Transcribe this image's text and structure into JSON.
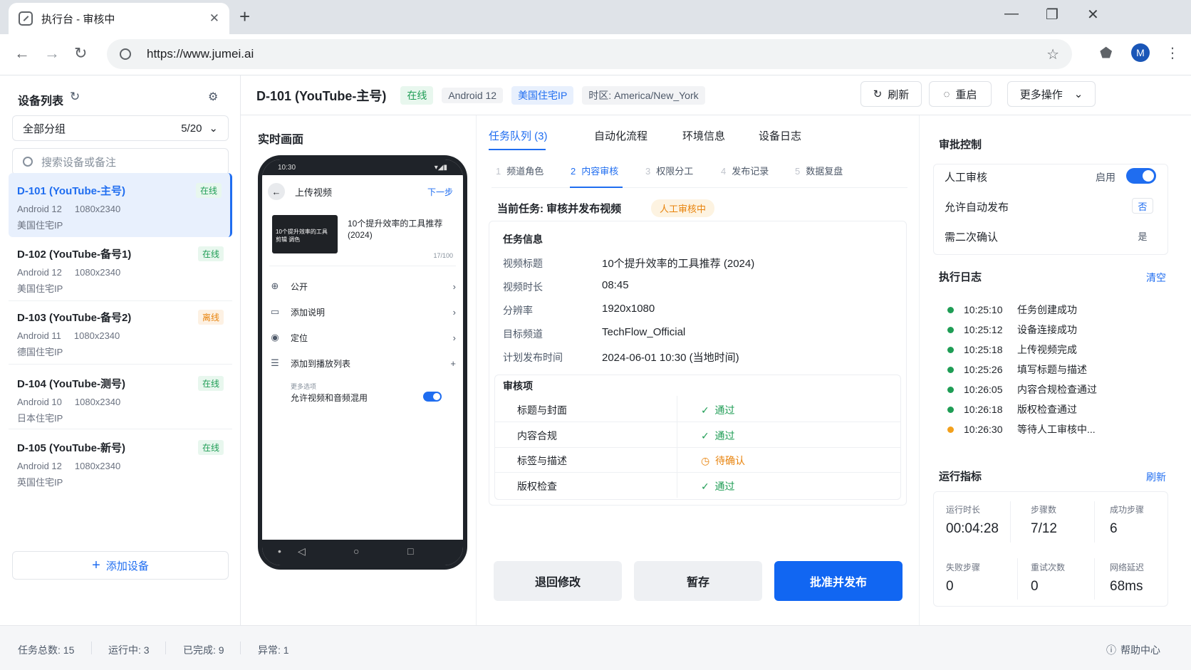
{
  "browser": {
    "tab_title": "执行台 - 审核中",
    "url": "https://www.jumei.ai",
    "avatar_letter": "M"
  },
  "sidebar": {
    "title": "设备列表",
    "group": {
      "label": "全部分组",
      "count": "5/20"
    },
    "search_placeholder": "搜索设备或备注",
    "devices": [
      {
        "name": "D-101 (YouTube-主号)",
        "status": "在线",
        "os": "Android 12",
        "res": "1080x2340",
        "loc": "美国住宅IP"
      },
      {
        "name": "D-102 (YouTube-备号1)",
        "status": "在线",
        "os": "Android 12",
        "res": "1080x2340",
        "loc": "美国住宅IP"
      },
      {
        "name": "D-103 (YouTube-备号2)",
        "status": "离线",
        "os": "Android 11",
        "res": "1080x2340",
        "loc": "德国住宅IP"
      },
      {
        "name": "D-104 (YouTube-测号)",
        "status": "在线",
        "os": "Android 10",
        "res": "1080x2340",
        "loc": "日本住宅IP"
      },
      {
        "name": "D-105 (YouTube-新号)",
        "status": "在线",
        "os": "Android 12",
        "res": "1080x2340",
        "loc": "英国住宅IP"
      }
    ],
    "add_device": "添加设备"
  },
  "header": {
    "device_title": "D-101 (YouTube-主号)",
    "tags": {
      "status": "在线",
      "os": "Android 12",
      "ip": "美国住宅IP",
      "tz": "时区: America/New_York"
    },
    "refresh": "刷新",
    "restart": "重启",
    "more": "更多操作"
  },
  "live": {
    "title": "实时画面",
    "status_time": "10:30",
    "status_icons": "▾◢▮",
    "page_title": "上传视频",
    "next": "下一步",
    "thumb_text": "10个提升效率的工具 剪辑 调色",
    "video_title": "10个提升效率的工具推荐 (2024)",
    "char_count": "17/100",
    "rows": [
      {
        "label": "公开",
        "icon": "globe-icon",
        "action": "›"
      },
      {
        "label": "添加说明",
        "icon": "comment-icon",
        "action": "›"
      },
      {
        "label": "定位",
        "icon": "location-icon",
        "action": "›"
      },
      {
        "label": "添加到播放列表",
        "icon": "playlist-icon",
        "action": "+"
      }
    ],
    "more_options": "更多选项",
    "mix_audio": "允许视频和音频混用"
  },
  "main_tabs": [
    "任务队列 (3)",
    "自动化流程",
    "环境信息",
    "设备日志"
  ],
  "steps": [
    {
      "n": "1",
      "label": "频道角色"
    },
    {
      "n": "2",
      "label": "内容审核"
    },
    {
      "n": "3",
      "label": "权限分工"
    },
    {
      "n": "4",
      "label": "发布记录"
    },
    {
      "n": "5",
      "label": "数据复盘"
    }
  ],
  "task": {
    "current": "当前任务: 审核并发布视频",
    "state": "人工审核中",
    "info_title": "任务信息",
    "info": [
      {
        "k": "视频标题",
        "v": "10个提升效率的工具推荐 (2024)"
      },
      {
        "k": "视频时长",
        "v": "08:45"
      },
      {
        "k": "分辨率",
        "v": "1920x1080"
      },
      {
        "k": "目标频道",
        "v": "TechFlow_Official"
      },
      {
        "k": "计划发布时间",
        "v": "2024-06-01 10:30 (当地时间)"
      }
    ],
    "review_title": "审核项",
    "review": [
      {
        "k": "标题与封面",
        "v": "通过",
        "mark": "✓"
      },
      {
        "k": "内容合规",
        "v": "通过",
        "mark": "✓"
      },
      {
        "k": "标签与描述",
        "v": "待确认",
        "mark": "◷"
      },
      {
        "k": "版权检查",
        "v": "通过",
        "mark": "✓"
      }
    ],
    "btn_return": "退回修改",
    "btn_save": "暂存",
    "btn_approve": "批准并发布"
  },
  "approval": {
    "title": "审批控制",
    "manual": {
      "label": "人工审核",
      "value": "启用"
    },
    "auto": {
      "label": "允许自动发布",
      "value": "否"
    },
    "second": {
      "label": "需二次确认",
      "value": "是"
    }
  },
  "log": {
    "title": "执行日志",
    "clear": "清空",
    "entries": [
      {
        "t": "10:25:10",
        "m": "任务创建成功"
      },
      {
        "t": "10:25:12",
        "m": "设备连接成功"
      },
      {
        "t": "10:25:18",
        "m": "上传视频完成"
      },
      {
        "t": "10:25:26",
        "m": "填写标题与描述"
      },
      {
        "t": "10:26:05",
        "m": "内容合规检查通过"
      },
      {
        "t": "10:26:18",
        "m": "版权检查通过"
      },
      {
        "t": "10:26:30",
        "m": "等待人工审核中..."
      }
    ]
  },
  "metrics": {
    "title": "运行指标",
    "refresh": "刷新",
    "items": [
      {
        "k": "运行时长",
        "v": "00:04:28"
      },
      {
        "k": "步骤数",
        "v": "7/12"
      },
      {
        "k": "成功步骤",
        "v": "6"
      },
      {
        "k": "失败步骤",
        "v": "0"
      },
      {
        "k": "重试次数",
        "v": "0"
      },
      {
        "k": "网络延迟",
        "v": "68ms"
      }
    ]
  },
  "footer": {
    "total": "任务总数: 15",
    "running": "运行中: 3",
    "done": "已完成: 9",
    "error": "异常: 1",
    "help": "帮助中心"
  }
}
